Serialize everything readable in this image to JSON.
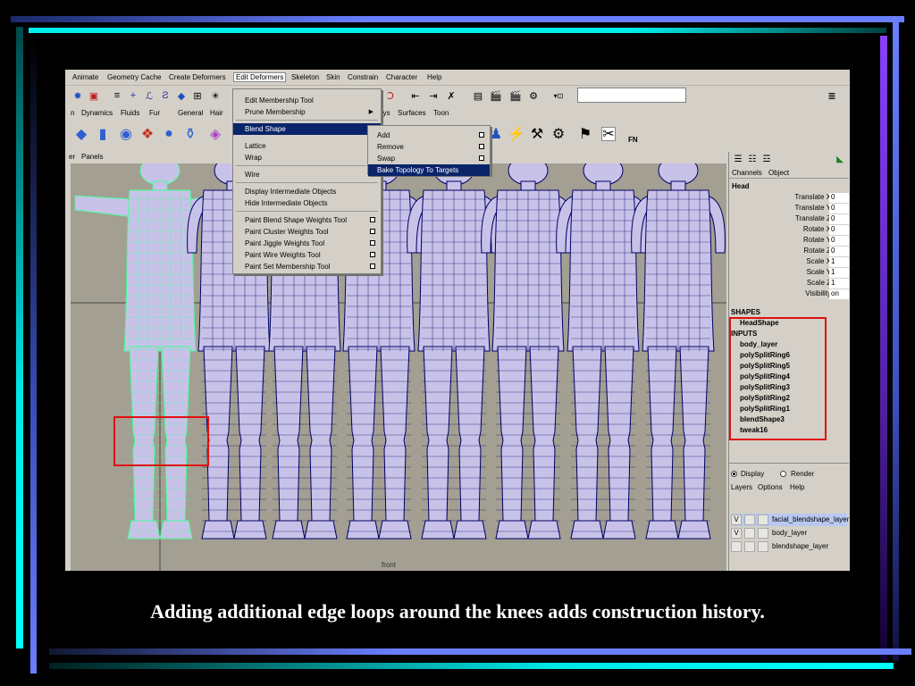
{
  "menubar": {
    "items": [
      "Animate",
      "Geometry Cache",
      "Create Deformers",
      "Edit Deformers",
      "Skeleton",
      "Skin",
      "Constrain",
      "Character",
      "Help"
    ]
  },
  "shelf_tabs": [
    "n",
    "Dynamics",
    "Fluids",
    "Fur",
    "General",
    "Hair",
    "...ys",
    "Surfaces",
    "Toon"
  ],
  "panel_menu": [
    "er",
    "Panels"
  ],
  "edit_deformers_menu": {
    "items": [
      {
        "label": "Edit Membership Tool",
        "type": "item"
      },
      {
        "label": "Prune Membership",
        "type": "submenu"
      },
      {
        "label": "Blend Shape",
        "type": "submenu",
        "highlighted": true
      },
      {
        "label": "Lattice",
        "type": "submenu"
      },
      {
        "label": "Wrap",
        "type": "submenu"
      },
      {
        "label": "Wire",
        "type": "submenu"
      },
      {
        "label": "Display Intermediate Objects",
        "type": "item"
      },
      {
        "label": "Hide Intermediate Objects",
        "type": "item"
      },
      {
        "label": "Paint Blend Shape Weights Tool",
        "type": "option"
      },
      {
        "label": "Paint Cluster Weights Tool",
        "type": "option"
      },
      {
        "label": "Paint Jiggle Weights Tool",
        "type": "option"
      },
      {
        "label": "Paint Wire Weights Tool",
        "type": "option"
      },
      {
        "label": "Paint Set Membership Tool",
        "type": "option"
      }
    ]
  },
  "blend_shape_submenu": {
    "items": [
      {
        "label": "Add",
        "option": true
      },
      {
        "label": "Remove",
        "option": true
      },
      {
        "label": "Swap",
        "option": true
      },
      {
        "label": "Bake Topology To Targets",
        "highlighted": true
      }
    ]
  },
  "channel_box": {
    "tabs": [
      "Channels",
      "Object"
    ],
    "object_name": "Head",
    "channels": [
      {
        "label": "Translate X",
        "value": "0"
      },
      {
        "label": "Translate Y",
        "value": "0"
      },
      {
        "label": "Translate Z",
        "value": "0"
      },
      {
        "label": "Rotate X",
        "value": "0"
      },
      {
        "label": "Rotate Y",
        "value": "0"
      },
      {
        "label": "Rotate Z",
        "value": "0"
      },
      {
        "label": "Scale X",
        "value": "1"
      },
      {
        "label": "Scale Y",
        "value": "1"
      },
      {
        "label": "Scale Z",
        "value": "1"
      },
      {
        "label": "Visibility",
        "value": "on"
      }
    ],
    "shapes_header": "SHAPES",
    "shape_name": "HeadShape",
    "inputs_header": "INPUTS",
    "inputs": [
      "body_layer",
      "polySplitRing6",
      "polySplitRing5",
      "polySplitRing4",
      "polySplitRing3",
      "polySplitRing2",
      "polySplitRing1",
      "blendShape3",
      "tweak16"
    ]
  },
  "layer_editor": {
    "display_label": "Display",
    "render_label": "Render",
    "menu": [
      "Layers",
      "Options",
      "Help"
    ],
    "layers": [
      {
        "visible": "V",
        "name": "facial_blendshape_layer",
        "selected": true
      },
      {
        "visible": "V",
        "name": "body_layer",
        "selected": false
      },
      {
        "visible": "",
        "name": "blendshape_layer",
        "selected": false
      }
    ]
  },
  "viewport": {
    "camera_label": "front"
  },
  "shelf_label": "FN",
  "caption": "Adding additional edge loops around the knees adds construction history.",
  "colors": {
    "highlight": "#0a246a",
    "wireframe": "#000066",
    "selected_wire": "#44ff99",
    "body_fill": "#c8c2e8",
    "callout_red": "#e01010",
    "slide_accent_blue": "#6a7fff",
    "slide_accent_cyan": "#00f0f0"
  }
}
